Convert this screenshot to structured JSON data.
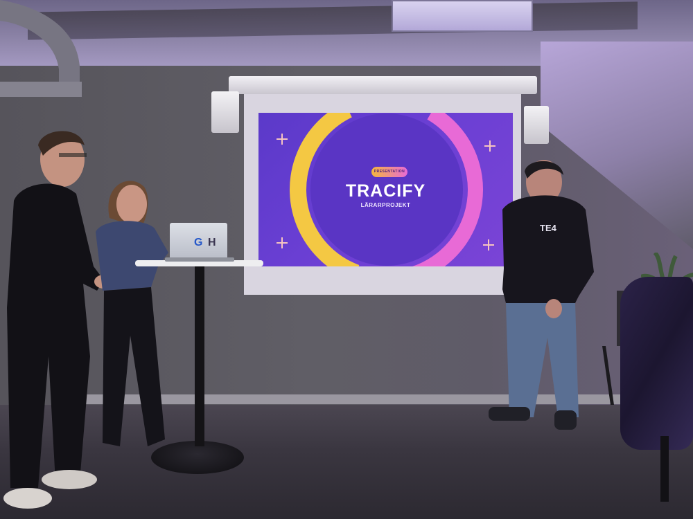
{
  "photo": {
    "subject": "",
    "screen": {
      "slide": {
        "badge": "PRESENTATION",
        "title": "TRACIFY",
        "subtitle": "LÄRARPROJEKT",
        "background_color": "#6a3fd3",
        "ring_colors": [
          "#f4c843",
          "#e86ad6"
        ]
      }
    },
    "laptop": {
      "sticker_left": "G",
      "sticker_right": "H"
    },
    "hoodie_print": {
      "chest_text": "TE4"
    }
  }
}
